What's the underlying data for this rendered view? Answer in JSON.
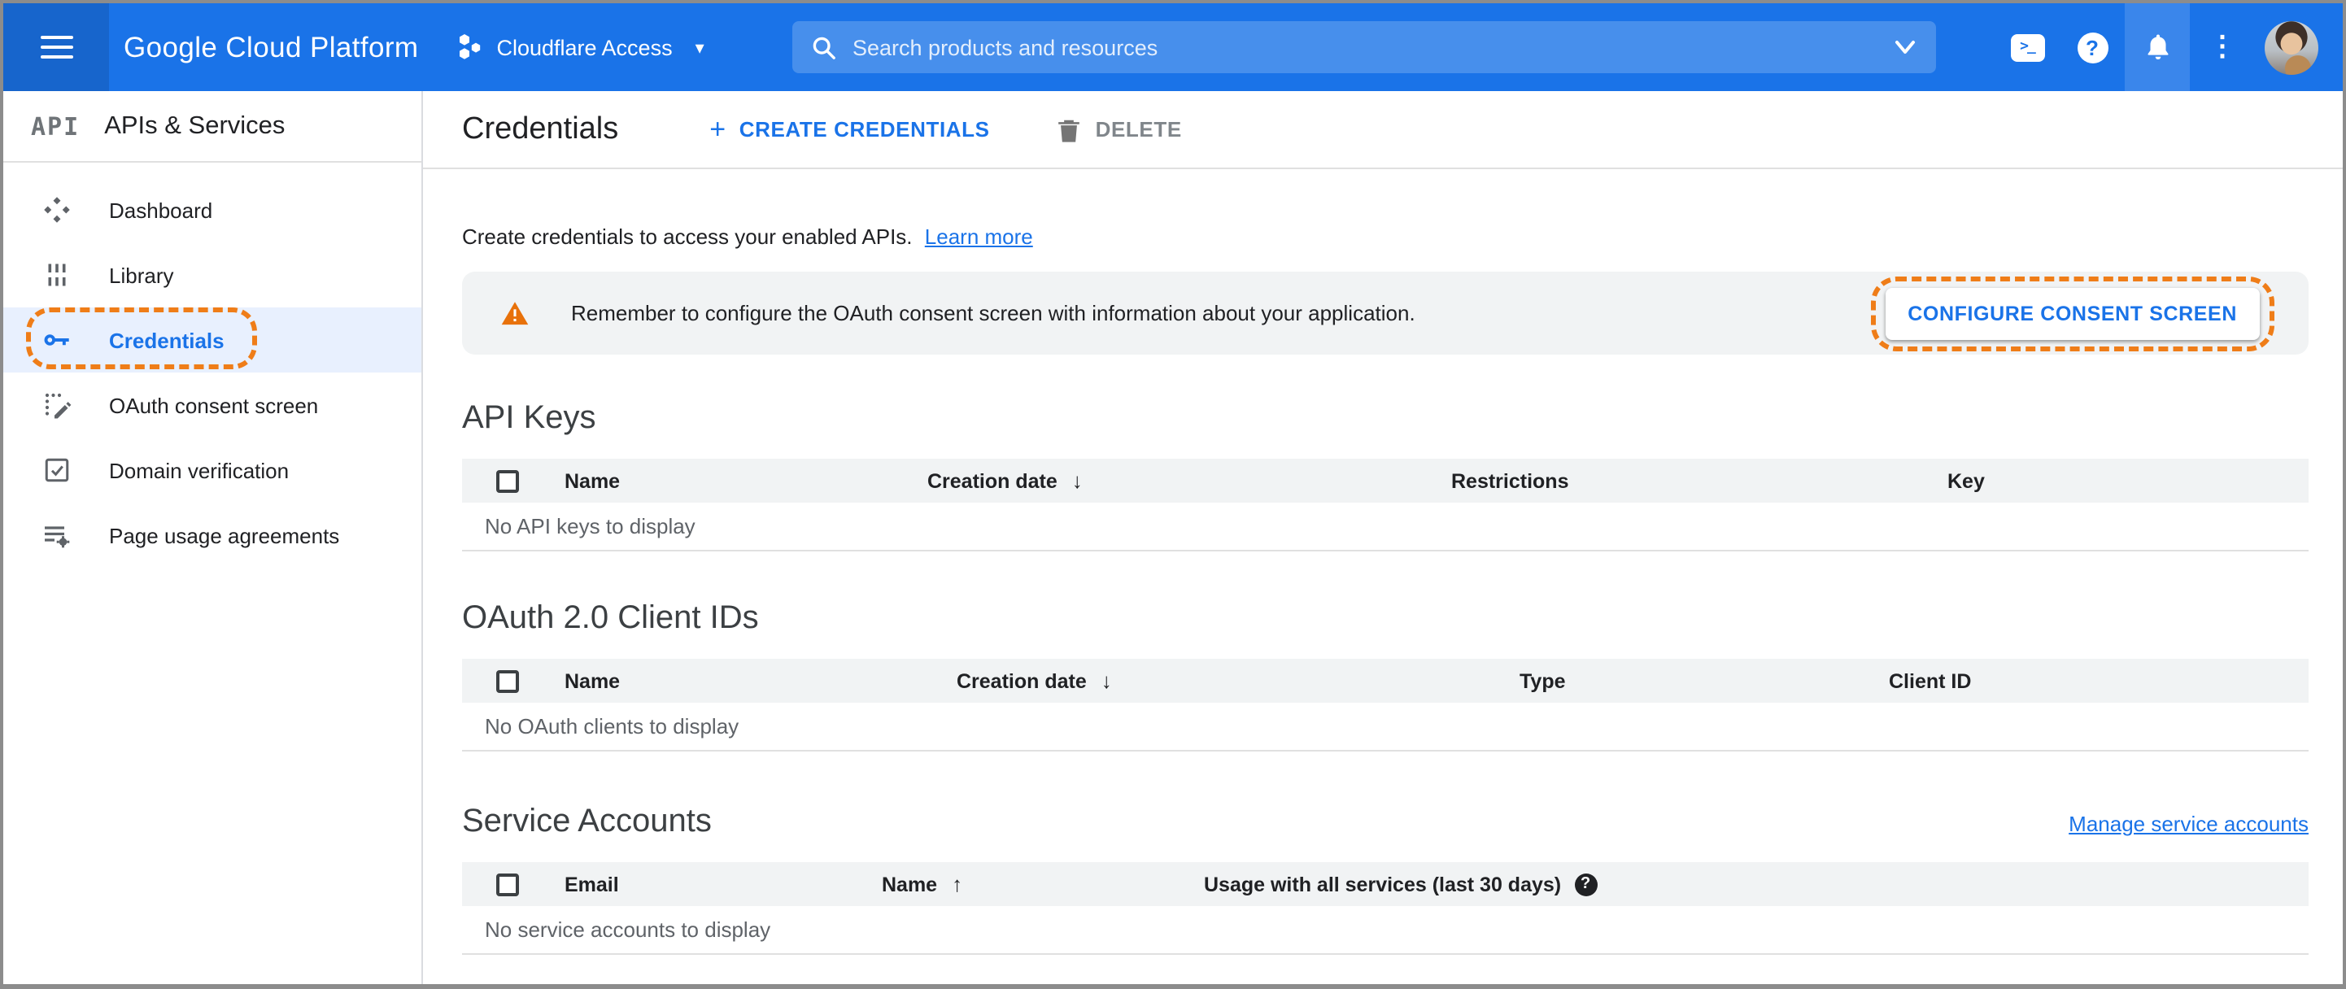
{
  "topbar": {
    "product": "Google Cloud Platform",
    "project": "Cloudflare Access",
    "search_placeholder": "Search products and resources"
  },
  "sidebar": {
    "logo": "API",
    "header": "APIs & Services",
    "items": [
      {
        "label": "Dashboard"
      },
      {
        "label": "Library"
      },
      {
        "label": "Credentials",
        "selected": true
      },
      {
        "label": "OAuth consent screen"
      },
      {
        "label": "Domain verification"
      },
      {
        "label": "Page usage agreements"
      }
    ]
  },
  "page": {
    "title": "Credentials",
    "create_button": "CREATE CREDENTIALS",
    "delete_button": "DELETE",
    "intro": "Create credentials to access your enabled APIs.",
    "learn_more": "Learn more",
    "banner": {
      "text": "Remember to configure the OAuth consent screen with information about your application.",
      "button": "CONFIGURE CONSENT SCREEN"
    }
  },
  "sections": {
    "api_keys": {
      "title": "API Keys",
      "col_name": "Name",
      "col_creation": "Creation date",
      "col_restrictions": "Restrictions",
      "col_key": "Key",
      "empty": "No API keys to display"
    },
    "oauth": {
      "title": "OAuth 2.0 Client IDs",
      "col_name": "Name",
      "col_creation": "Creation date",
      "col_type": "Type",
      "col_client_id": "Client ID",
      "empty": "No OAuth clients to display"
    },
    "service_accounts": {
      "title": "Service Accounts",
      "manage_link": "Manage service accounts",
      "col_email": "Email",
      "col_name": "Name",
      "col_usage": "Usage with all services (last 30 days)",
      "empty": "No service accounts to display"
    }
  },
  "icons": {
    "sort_desc": "↓",
    "sort_asc": "↑",
    "more_vertical": "⋮",
    "dropdown_arrow": "▾",
    "plus": "+",
    "question": "?",
    "terminal": ">_"
  },
  "colors": {
    "accent_blue": "#1a73e8",
    "topbar_blue": "#1a73e8",
    "topbar_dark_blue": "#1765cc",
    "selected_row_blue": "#e8f0fe",
    "highlight_orange": "#ef7d18",
    "warning_orange": "#e8710a",
    "banner_gray": "#f1f3f4"
  }
}
